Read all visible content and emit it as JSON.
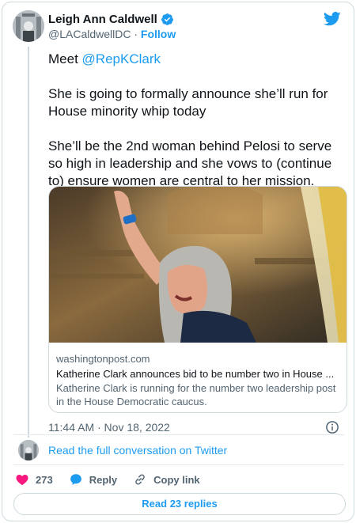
{
  "author": {
    "name": "Leigh Ann Caldwell",
    "handle": "@LACaldwellDC",
    "separator": " · ",
    "follow_label": "Follow"
  },
  "tweet": {
    "intro": "Meet ",
    "mention": "@RepKClark",
    "paragraph_2": "She is going to formally announce she’ll run for House minority whip today",
    "paragraph_3": "She’ll be the 2nd woman behind Pelosi to serve so high in leadership and she vows to (continue to) ensure women are central to her mission."
  },
  "link_card": {
    "domain": "washingtonpost.com",
    "title": "Katherine Clark announces bid to be number two in House ...",
    "description": "Katherine Clark is running for the number two leadership post in the House Democratic caucus."
  },
  "timestamp": "11:44 AM · Nov 18, 2022",
  "full_conversation_label": "Read the full conversation on Twitter",
  "actions": {
    "like_count": "273",
    "reply_label": "Reply",
    "copy_link_label": "Copy link"
  },
  "read_replies_label": "Read 23 replies",
  "icons": {
    "brand": "twitter-bird-icon",
    "verified": "verified-badge-icon",
    "info": "info-icon",
    "like": "heart-icon",
    "reply": "reply-bubble-icon",
    "copy": "link-icon"
  },
  "colors": {
    "accent": "#1d9bf0",
    "like": "#f91880",
    "text": "#0f1419",
    "muted": "#536471",
    "border": "#cfd9de"
  }
}
